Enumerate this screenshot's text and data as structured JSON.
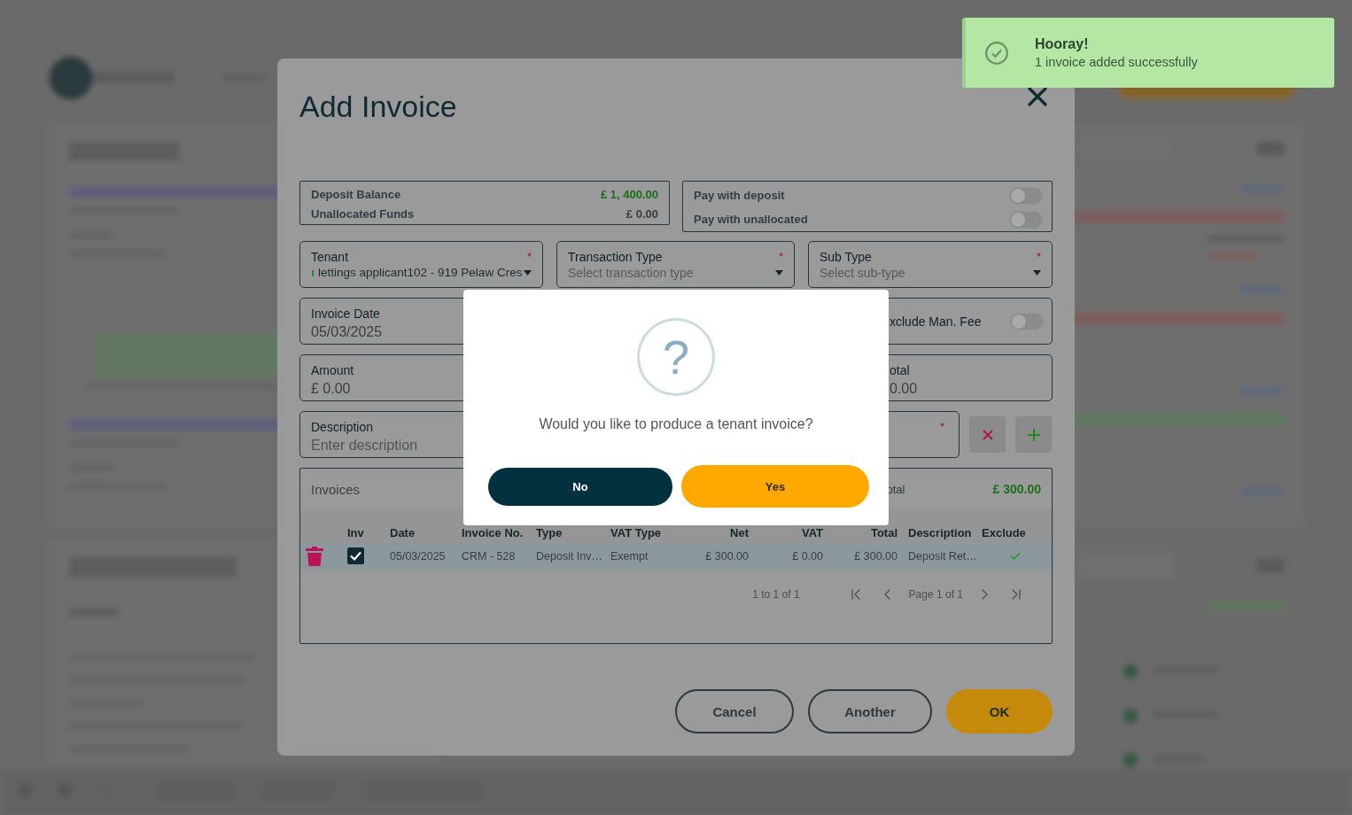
{
  "toast": {
    "title": "Hooray!",
    "message": "1 invoice added successfully"
  },
  "modal": {
    "title": "Add Invoice",
    "balances": [
      {
        "label": "Deposit Balance",
        "value": "£ 1, 400.00",
        "color": "#1b6e1b"
      },
      {
        "label": "Unallocated Funds",
        "value": "£ 0.00",
        "color": "#3c3c3c"
      }
    ],
    "payment_toggles": [
      {
        "label": "Pay with deposit",
        "on": false
      },
      {
        "label": "Pay with unallocated",
        "on": false
      }
    ],
    "field_rows": [
      [
        {
          "kind": "select",
          "label": "Tenant",
          "value": "lettings applicant102 - 919 Pelaw Cres",
          "required_mark": "*"
        },
        {
          "kind": "select",
          "label": "Transaction Type",
          "placeholder": "Select transaction type",
          "required_mark": "*"
        },
        {
          "kind": "select",
          "label": "Sub Type",
          "placeholder": "Select sub-type",
          "required_mark": "*"
        }
      ],
      [
        {
          "kind": "input",
          "label": "Invoice Date",
          "value": "05/03/2025"
        },
        {
          "kind": "toggle",
          "label": "xclude Man. Fee",
          "on": false
        }
      ],
      [
        {
          "kind": "input",
          "label": "Amount",
          "value": "£ 0.00"
        },
        {
          "kind": "input",
          "label": "otal",
          "value": "0.00"
        }
      ]
    ],
    "description": {
      "label": "Description",
      "placeholder": "Enter description",
      "required_mark": "*"
    },
    "invoices": {
      "title": "Invoices",
      "total_label": "otal",
      "total": "£ 300.00",
      "columns": [
        {
          "label": "Inv",
          "kind": "check"
        },
        {
          "label": "Date",
          "kind": "text"
        },
        {
          "label": "Invoice No.",
          "kind": "text"
        },
        {
          "label": "Type",
          "kind": "text"
        },
        {
          "label": "VAT Type",
          "kind": "text"
        },
        {
          "label": "Net",
          "kind": "amount"
        },
        {
          "label": "VAT",
          "kind": "amount"
        },
        {
          "label": "Total",
          "kind": "amount"
        },
        {
          "label": "Description",
          "kind": "text"
        },
        {
          "label": "Exclude",
          "kind": "flag"
        }
      ],
      "rows": [
        {
          "selected": true,
          "checked": true,
          "exclude": true,
          "cells": [
            "",
            "05/03/2025",
            "CRM - 528",
            "Deposit Inv…",
            "Exempt",
            "£ 300.00",
            "£ 0.00",
            "£ 300.00",
            "Deposit Ret…"
          ]
        }
      ],
      "pagination": {
        "range": "1 to 1 of 1",
        "page": "Page 1 of 1"
      }
    },
    "buttons": [
      {
        "label": "Cancel",
        "kind": "outline"
      },
      {
        "label": "Another",
        "kind": "outline"
      },
      {
        "label": "OK",
        "kind": "primary"
      }
    ]
  },
  "dialog": {
    "icon_glyph": "?",
    "message": "Would you like to produce a tenant invoice?",
    "buttons": [
      {
        "label": "No",
        "kind": "secondary"
      },
      {
        "label": "Yes",
        "kind": "primary"
      }
    ]
  }
}
